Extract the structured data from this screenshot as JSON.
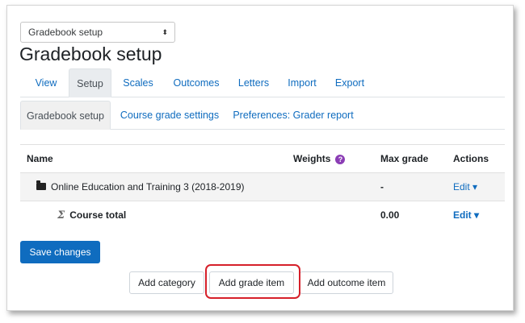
{
  "jump": {
    "selected": "Gradebook setup",
    "caret": "⬍"
  },
  "page_title": "Gradebook setup",
  "tabs": [
    {
      "label": "View"
    },
    {
      "label": "Setup"
    },
    {
      "label": "Scales"
    },
    {
      "label": "Outcomes"
    },
    {
      "label": "Letters"
    },
    {
      "label": "Import"
    },
    {
      "label": "Export"
    }
  ],
  "subtabs": [
    {
      "label": "Gradebook setup"
    },
    {
      "label": "Course grade settings"
    },
    {
      "label": "Preferences: Grader report"
    }
  ],
  "table": {
    "headers": {
      "name": "Name",
      "weights": "Weights",
      "max_grade": "Max grade",
      "actions": "Actions"
    },
    "rows": [
      {
        "name": "Online Education and Training 3 (2018-2019)",
        "max_grade": "-",
        "action": "Edit ▾"
      },
      {
        "name": "Course total",
        "max_grade": "0.00",
        "action": "Edit ▾"
      }
    ]
  },
  "buttons": {
    "save": "Save changes",
    "add_category": "Add category",
    "add_grade_item": "Add grade item",
    "add_outcome_item": "Add outcome item"
  },
  "colors": {
    "link": "#0f6cbf",
    "primary": "#0f6cbf",
    "highlight": "#d6202a",
    "help": "#8b3db5"
  }
}
